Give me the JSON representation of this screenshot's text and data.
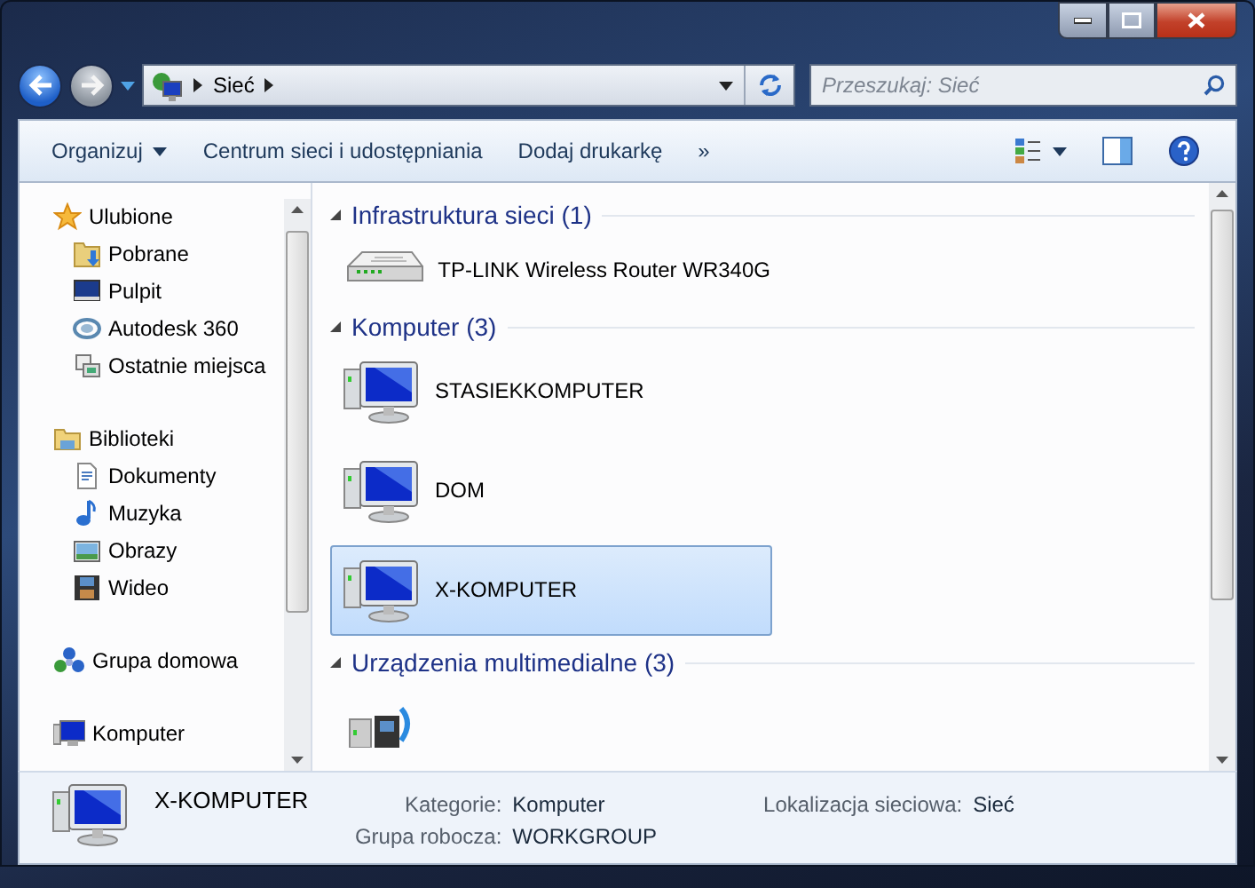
{
  "address_bar": {
    "path": [
      "Sieć"
    ]
  },
  "search": {
    "placeholder": "Przeszukaj: Sieć"
  },
  "toolbar": {
    "items": [
      {
        "label": "Organizuj",
        "dropdown": true
      },
      {
        "label": "Centrum sieci i udostępniania",
        "dropdown": false
      },
      {
        "label": "Dodaj drukarkę",
        "dropdown": false
      }
    ],
    "overflow": "»"
  },
  "sidebar": {
    "groups": [
      {
        "label": "Ulubione",
        "kind": "star",
        "children": [
          {
            "label": "Pobrane",
            "kind": "download"
          },
          {
            "label": "Pulpit",
            "kind": "desktop"
          },
          {
            "label": "Autodesk 360",
            "kind": "cloud"
          },
          {
            "label": "Ostatnie miejsca",
            "kind": "recent"
          }
        ]
      },
      {
        "label": "Biblioteki",
        "kind": "folder",
        "children": [
          {
            "label": "Dokumenty",
            "kind": "document"
          },
          {
            "label": "Muzyka",
            "kind": "music"
          },
          {
            "label": "Obrazy",
            "kind": "picture"
          },
          {
            "label": "Wideo",
            "kind": "video"
          }
        ]
      },
      {
        "label": "Grupa domowa",
        "kind": "homegroup"
      },
      {
        "label": "Komputer",
        "kind": "computer"
      }
    ]
  },
  "content": {
    "groups": [
      {
        "title": "Infrastruktura sieci (1)",
        "expanded": true,
        "items": [
          {
            "label": "TP-LINK Wireless Router WR340G",
            "kind": "router",
            "selected": false
          }
        ]
      },
      {
        "title": "Komputer (3)",
        "expanded": true,
        "items": [
          {
            "label": "STASIEKKOMPUTER",
            "kind": "computer",
            "selected": false
          },
          {
            "label": "DOM",
            "kind": "computer",
            "selected": false
          },
          {
            "label": "X-KOMPUTER",
            "kind": "computer",
            "selected": true
          }
        ]
      },
      {
        "title": "Urządzenia multimedialne (3)",
        "expanded": true,
        "items": [
          {
            "kind": "media",
            "selected": false
          }
        ]
      }
    ]
  },
  "details": {
    "name": "X-KOMPUTER",
    "fields": [
      {
        "label": "Kategorie:",
        "value": "Komputer"
      },
      {
        "label": "Grupa robocza:",
        "value": "WORKGROUP"
      },
      {
        "label": "Lokalizacja sieciowa:",
        "value": "Sieć"
      }
    ]
  }
}
